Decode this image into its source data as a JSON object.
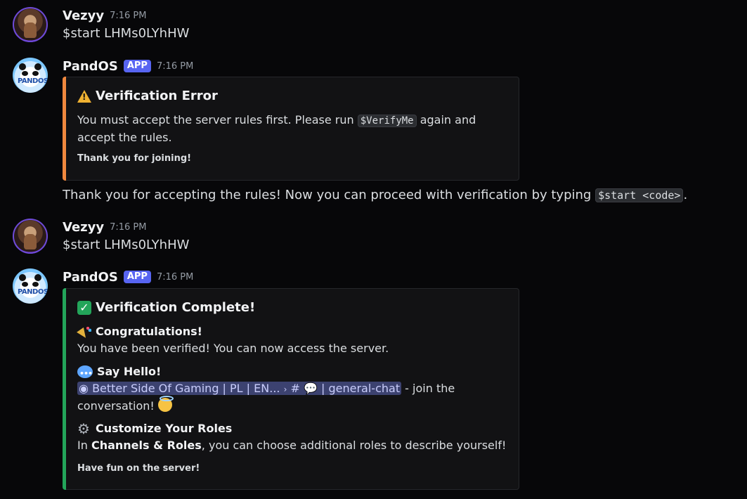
{
  "messages": [
    {
      "author": "Vezyy",
      "time": "7:16 PM",
      "text": "$start LHMs0LYhHW"
    },
    {
      "author": "PandOS",
      "tag": "APP",
      "time": "7:16 PM",
      "embed": {
        "color": "#f0883e",
        "title": "Verification Error",
        "body_pre": "You must accept the server rules first. Please run ",
        "body_code": "$VerifyMe",
        "body_post": " again and accept the rules.",
        "footer": "Thank you for joining!"
      },
      "followup_pre": "Thank you for accepting the rules! Now you can proceed with verification by typing ",
      "followup_code": "$start <code>",
      "followup_post": "."
    },
    {
      "author": "Vezyy",
      "time": "7:16 PM",
      "text": "$start LHMs0LYhHW"
    },
    {
      "author": "PandOS",
      "tag": "APP",
      "time": "7:16 PM",
      "embed": {
        "color": "#23a55a",
        "title": "Verification Complete!",
        "sec1_title": "Congratulations!",
        "sec1_text": "You have been verified! You can now access the server.",
        "sec2_title": "Say Hello!",
        "channel_server": "Better Side Of Gaming | PL | EN...",
        "channel_sep": "›",
        "channel_hash": "#",
        "channel_name": "| general-chat",
        "sec2_text_post": " - join the",
        "sec2_text_line2": "conversation!",
        "sec3_title": "Customize Your Roles",
        "sec3_pre": "In ",
        "sec3_bold": "Channels & Roles",
        "sec3_post": ", you can choose additional roles to describe yourself!",
        "footer": "Have fun on the server!"
      }
    }
  ],
  "avatar_bot_text": "PANDOS"
}
